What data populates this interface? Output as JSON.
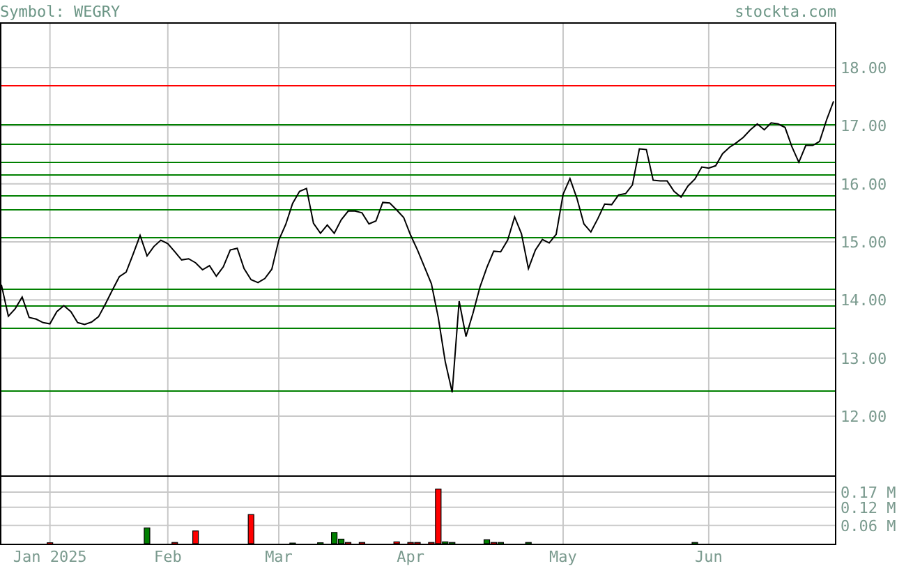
{
  "header": {
    "symbol": "Symbol: WEGRY",
    "site": "stockta.com"
  },
  "price_chart": {
    "chart_data": {
      "type": "line",
      "ylim": [
        10.98,
        18.78
      ],
      "yticks": [
        {
          "value": 12,
          "label": "12.00"
        },
        {
          "value": 13,
          "label": "13.00"
        },
        {
          "value": 14,
          "label": "14.00"
        },
        {
          "value": 15,
          "label": "15.00"
        },
        {
          "value": 16,
          "label": "16.00"
        },
        {
          "value": 17,
          "label": "17.00"
        },
        {
          "value": 18,
          "label": "18.00"
        }
      ],
      "values": [
        14.26,
        13.72,
        13.85,
        14.05,
        13.7,
        13.67,
        13.61,
        13.59,
        13.8,
        13.9,
        13.8,
        13.61,
        13.58,
        13.62,
        13.71,
        13.93,
        14.17,
        14.4,
        14.48,
        14.79,
        15.11,
        14.76,
        14.92,
        15.03,
        14.97,
        14.83,
        14.69,
        14.71,
        14.64,
        14.52,
        14.59,
        14.41,
        14.57,
        14.86,
        14.89,
        14.54,
        14.35,
        14.3,
        14.37,
        14.53,
        15.03,
        15.3,
        15.66,
        15.87,
        15.92,
        15.32,
        15.15,
        15.29,
        15.15,
        15.38,
        15.53,
        15.53,
        15.5,
        15.31,
        15.36,
        15.68,
        15.67,
        15.55,
        15.42,
        15.12,
        14.86,
        14.57,
        14.28,
        13.7,
        12.94,
        12.41,
        13.98,
        13.37,
        13.77,
        14.22,
        14.56,
        14.84,
        14.83,
        15.03,
        15.43,
        15.14,
        14.54,
        14.86,
        15.04,
        14.98,
        15.13,
        15.82,
        16.09,
        15.75,
        15.31,
        15.17,
        15.4,
        15.65,
        15.64,
        15.81,
        15.83,
        15.98,
        16.6,
        16.59,
        16.06,
        16.05,
        16.05,
        15.87,
        15.77,
        15.96,
        16.08,
        16.29,
        16.27,
        16.31,
        16.52,
        16.63,
        16.71,
        16.8,
        16.93,
        17.03,
        16.93,
        17.05,
        17.03,
        16.97,
        16.64,
        16.37,
        16.66,
        16.66,
        16.73,
        17.1,
        17.42
      ],
      "grid": true,
      "ref_lines": [
        {
          "axis": "y",
          "value": 17.69,
          "color": "#ff0000"
        },
        {
          "axis": "y",
          "value": 17.04,
          "color": "#008000"
        },
        {
          "axis": "y",
          "value": 16.7,
          "color": "#008000"
        },
        {
          "axis": "y",
          "value": 16.38,
          "color": "#008000"
        },
        {
          "axis": "y",
          "value": 16.17,
          "color": "#008000"
        },
        {
          "axis": "y",
          "value": 15.81,
          "color": "#008000"
        },
        {
          "axis": "y",
          "value": 15.57,
          "color": "#008000"
        },
        {
          "axis": "y",
          "value": 15.09,
          "color": "#008000"
        },
        {
          "axis": "y",
          "value": 14.2,
          "color": "#008000"
        },
        {
          "axis": "y",
          "value": 13.92,
          "color": "#008000"
        },
        {
          "axis": "y",
          "value": 13.53,
          "color": "#008000"
        },
        {
          "axis": "y",
          "value": 12.44,
          "color": "#008000"
        }
      ]
    }
  },
  "volume_chart": {
    "chart_data": {
      "type": "bar",
      "grid": true,
      "ylim": [
        0,
        0.225
      ],
      "yticks": [
        {
          "value": 0.06,
          "label": "0.06 M"
        },
        {
          "value": 0.12,
          "label": "0.12 M"
        },
        {
          "value": 0.17,
          "label": "0.17 M"
        }
      ],
      "categories": [
        null,
        null,
        null,
        null,
        null,
        null,
        null,
        "Jan 2025",
        null,
        null,
        null,
        null,
        null,
        null,
        null,
        null,
        null,
        null,
        null,
        null,
        null,
        null,
        null,
        null,
        "Feb",
        null,
        null,
        null,
        null,
        null,
        null,
        null,
        null,
        null,
        null,
        null,
        null,
        null,
        null,
        null,
        "Mar",
        null,
        null,
        null,
        null,
        null,
        null,
        null,
        null,
        null,
        null,
        null,
        null,
        null,
        null,
        null,
        null,
        null,
        null,
        "Apr",
        null,
        null,
        null,
        null,
        null,
        null,
        null,
        null,
        null,
        null,
        null,
        null,
        null,
        null,
        null,
        null,
        null,
        null,
        null,
        null,
        null,
        "May",
        null,
        null,
        null,
        null,
        null,
        null,
        null,
        null,
        null,
        null,
        null,
        null,
        null,
        null,
        null,
        null,
        null,
        null,
        null,
        null,
        "Jun",
        null,
        null,
        null,
        null,
        null,
        null,
        null,
        null,
        null,
        null,
        null,
        null,
        null,
        null,
        null,
        null,
        null,
        null
      ],
      "series": [
        {
          "color": "#008000",
          "values": [
            null,
            null,
            null,
            null,
            null,
            null,
            null,
            null,
            null,
            null,
            null,
            null,
            null,
            null,
            null,
            null,
            null,
            null,
            null,
            null,
            null,
            0.052,
            null,
            null,
            null,
            null,
            null,
            null,
            null,
            null,
            null,
            null,
            null,
            null,
            null,
            null,
            null,
            null,
            null,
            null,
            null,
            null,
            0.002,
            null,
            null,
            null,
            0.003,
            null,
            0.037,
            0.015,
            null,
            null,
            null,
            null,
            null,
            null,
            null,
            null,
            null,
            null,
            null,
            null,
            null,
            null,
            0.006,
            0.004,
            null,
            null,
            null,
            null,
            0.013,
            null,
            0.004,
            null,
            null,
            null,
            0.004,
            null,
            null,
            null,
            null,
            null,
            null,
            null,
            null,
            null,
            null,
            null,
            null,
            null,
            null,
            null,
            null,
            null,
            null,
            null,
            null,
            null,
            null,
            null,
            0.004,
            null,
            null,
            null,
            null,
            null,
            null,
            null,
            null,
            null,
            null,
            null,
            null,
            null,
            null,
            null,
            null,
            null,
            null,
            null,
            null
          ]
        },
        {
          "color": "#ff0000",
          "values": [
            null,
            null,
            null,
            null,
            null,
            null,
            null,
            0.003,
            null,
            null,
            null,
            null,
            null,
            null,
            null,
            null,
            null,
            null,
            null,
            null,
            null,
            null,
            null,
            null,
            null,
            0.004,
            null,
            null,
            0.042,
            null,
            null,
            null,
            null,
            null,
            null,
            null,
            0.096,
            null,
            null,
            null,
            null,
            null,
            null,
            null,
            null,
            null,
            null,
            null,
            null,
            null,
            0.004,
            null,
            0.004,
            null,
            null,
            null,
            null,
            0.006,
            null,
            0.004,
            0.004,
            null,
            0.004,
            0.18,
            null,
            null,
            null,
            null,
            null,
            null,
            null,
            0.004,
            null,
            null,
            null,
            null,
            null,
            null,
            null,
            null,
            null,
            null,
            null,
            null,
            null,
            null,
            null,
            null,
            null,
            null,
            null,
            null,
            null,
            null,
            null,
            null,
            null,
            null,
            null,
            null,
            null,
            null,
            null,
            null,
            null,
            null,
            null,
            null,
            null,
            null,
            null,
            null,
            null,
            null,
            null,
            null,
            null,
            null,
            null,
            null,
            null
          ]
        }
      ]
    }
  }
}
